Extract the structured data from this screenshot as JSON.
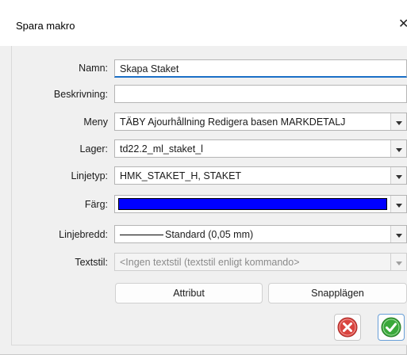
{
  "window": {
    "title": "Spara makro",
    "close_glyph": "✕"
  },
  "form": {
    "name_label": "Namn:",
    "name_value": "Skapa Staket",
    "description_label": "Beskrivning:",
    "description_value": "",
    "menu_label": "Meny",
    "menu_value": "TÄBY Ajourhållning Redigera basen MARKDETALJ",
    "layer_label": "Lager:",
    "layer_value": "td22.2_ml_staket_l",
    "linetype_label": "Linjetyp:",
    "linetype_value": "HMK_STAKET_H, STAKET",
    "color_label": "Färg:",
    "color_value": "#0000ff",
    "linewidth_label": "Linjebredd:",
    "linewidth_value": "Standard (0,05 mm)",
    "textstyle_label": "Textstil:",
    "textstyle_value": "<Ingen textstil (textstil enligt kommando>"
  },
  "buttons": {
    "attribute_label": "Attribut",
    "snap_label": "Snapplägen",
    "cancel_icon": "cancel-icon",
    "ok_icon": "ok-check-icon"
  },
  "colors": {
    "accent": "#1a6fc7",
    "cancel": "#d9443f",
    "ok": "#3aa83a"
  }
}
